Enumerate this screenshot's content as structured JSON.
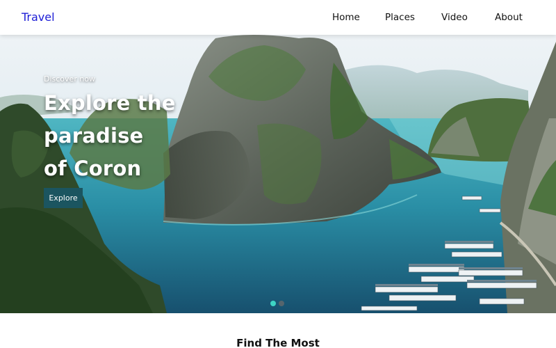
{
  "navbar": {
    "brand": "Travel",
    "links": [
      "Home",
      "Places",
      "Video",
      "About"
    ]
  },
  "hero": {
    "eyebrow": "Discover now",
    "headline_lines": [
      "Explore the",
      "paradise",
      "of Coron"
    ],
    "cta_label": "Explore",
    "slides": {
      "count": 2,
      "active_index": 0
    }
  },
  "section": {
    "heading": "Find The Most"
  },
  "colors": {
    "brand": "#1c1cd6",
    "cta_background": "#1b5560",
    "active_dot": "#3ed5c4",
    "nav_text": "#111111"
  }
}
